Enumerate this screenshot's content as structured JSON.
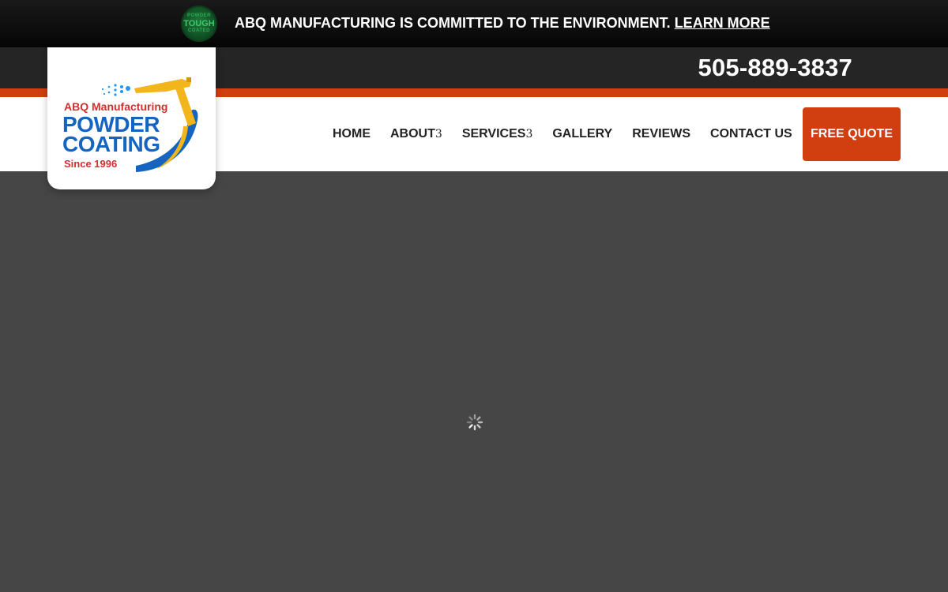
{
  "announcement": {
    "badge_top": "POWDER",
    "badge_main": "TOUGH",
    "badge_bottom": "COATED",
    "text": "ABQ MANUFACTURING IS COMMITTED TO THE ENVIRONMENT.",
    "link": "LEARN MORE"
  },
  "header": {
    "phone": "505-889-3837"
  },
  "logo": {
    "line1": "ABQ Manufacturing",
    "line2": "POWDER",
    "line3": "COATING",
    "line4": "Since 1996"
  },
  "nav": {
    "items": [
      {
        "label": "HOME",
        "caret": ""
      },
      {
        "label": "ABOUT",
        "caret": "3"
      },
      {
        "label": "SERVICES",
        "caret": "3"
      },
      {
        "label": "GALLERY",
        "caret": ""
      },
      {
        "label": "REVIEWS",
        "caret": ""
      },
      {
        "label": "CONTACT US",
        "caret": ""
      }
    ],
    "cta": "FREE QUOTE"
  },
  "colors": {
    "accent": "#d13f10",
    "topbar": "#0b0b0b",
    "phonebar": "#252525",
    "hero": "#464646",
    "logo_blue": "#1565c0",
    "logo_red": "#d32f2f",
    "logo_yellow": "#f2b51b"
  },
  "icons": {
    "badge": "tough-coated-badge-icon",
    "loading": "loading-spinner-icon",
    "spray_gun": "spray-gun-icon"
  }
}
